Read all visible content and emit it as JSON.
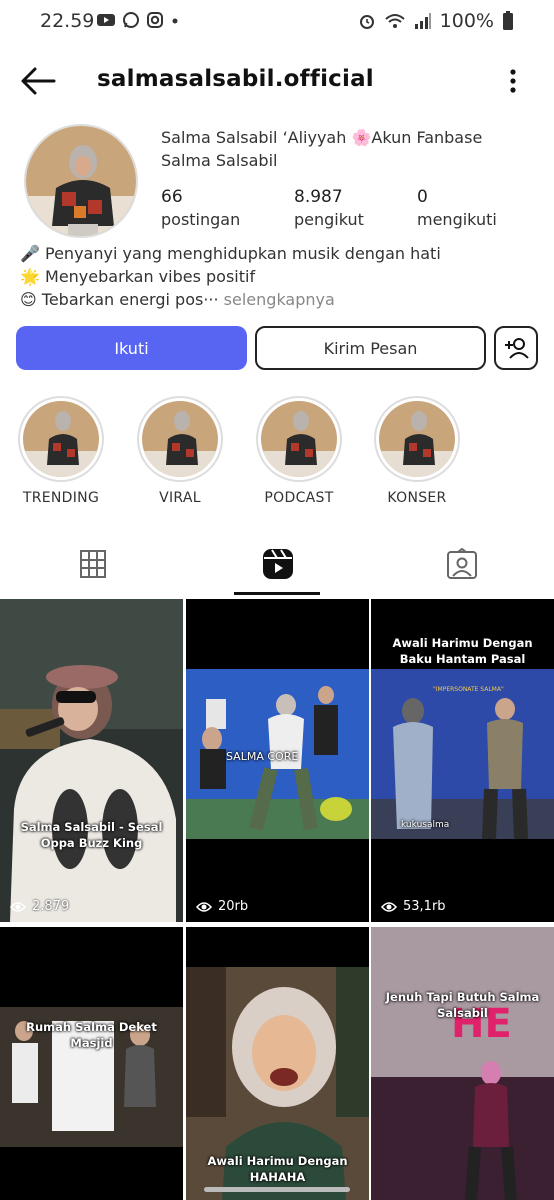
{
  "status_bar": {
    "time": "22.59",
    "battery": "100%",
    "icons_left": [
      "youtube-icon",
      "whatsapp-icon",
      "instagram-icon",
      "dot-icon"
    ],
    "icons_right": [
      "alarm-icon",
      "wifi-icon",
      "signal-icon",
      "battery-icon"
    ]
  },
  "header": {
    "username": "salmasalsabil.official"
  },
  "profile": {
    "display_name": "Salma Salsabil ‘Aliyyah 🌸Akun Fanbase Salma Salsabil",
    "stats": [
      {
        "value": "66",
        "label": "postingan"
      },
      {
        "value": "8.987",
        "label": "pengikut"
      },
      {
        "value": "0",
        "label": "mengikuti"
      }
    ],
    "bio": [
      "🎤 Penyanyi yang menghidupkan musik dengan hati",
      "🌟 Menyebarkan vibes positif",
      "😊 Tebarkan energi pos···"
    ],
    "bio_more": "selengkapnya"
  },
  "actions": {
    "follow": "Ikuti",
    "message": "Kirim Pesan"
  },
  "highlights": [
    {
      "label": "TRENDING"
    },
    {
      "label": "VIRAL"
    },
    {
      "label": "PODCAST"
    },
    {
      "label": "KONSER"
    }
  ],
  "tabs": {
    "active": "reels",
    "items": [
      "grid",
      "reels",
      "tagged"
    ]
  },
  "reels": [
    {
      "title": "Salma Salsabil - Sesal Oppa Buzz King",
      "views": "2.879"
    },
    {
      "title": "",
      "views": "20rb",
      "overlay_text": "SALMA CORE"
    },
    {
      "title": "Awali Harimu Dengan Baku Hantam Pasal",
      "views": "53,1rb",
      "overlay_text": "kukusalma"
    },
    {
      "title": "Rumah Salma Deket Masjid",
      "views": ""
    },
    {
      "title": "Awali Harimu Dengan HAHAHA",
      "views": ""
    },
    {
      "title": "Jenuh Tapi Butuh Salma Salsabil",
      "views": ""
    }
  ],
  "colors": {
    "follow_button": "#5865f2",
    "text": "#222222",
    "muted": "#888888"
  }
}
